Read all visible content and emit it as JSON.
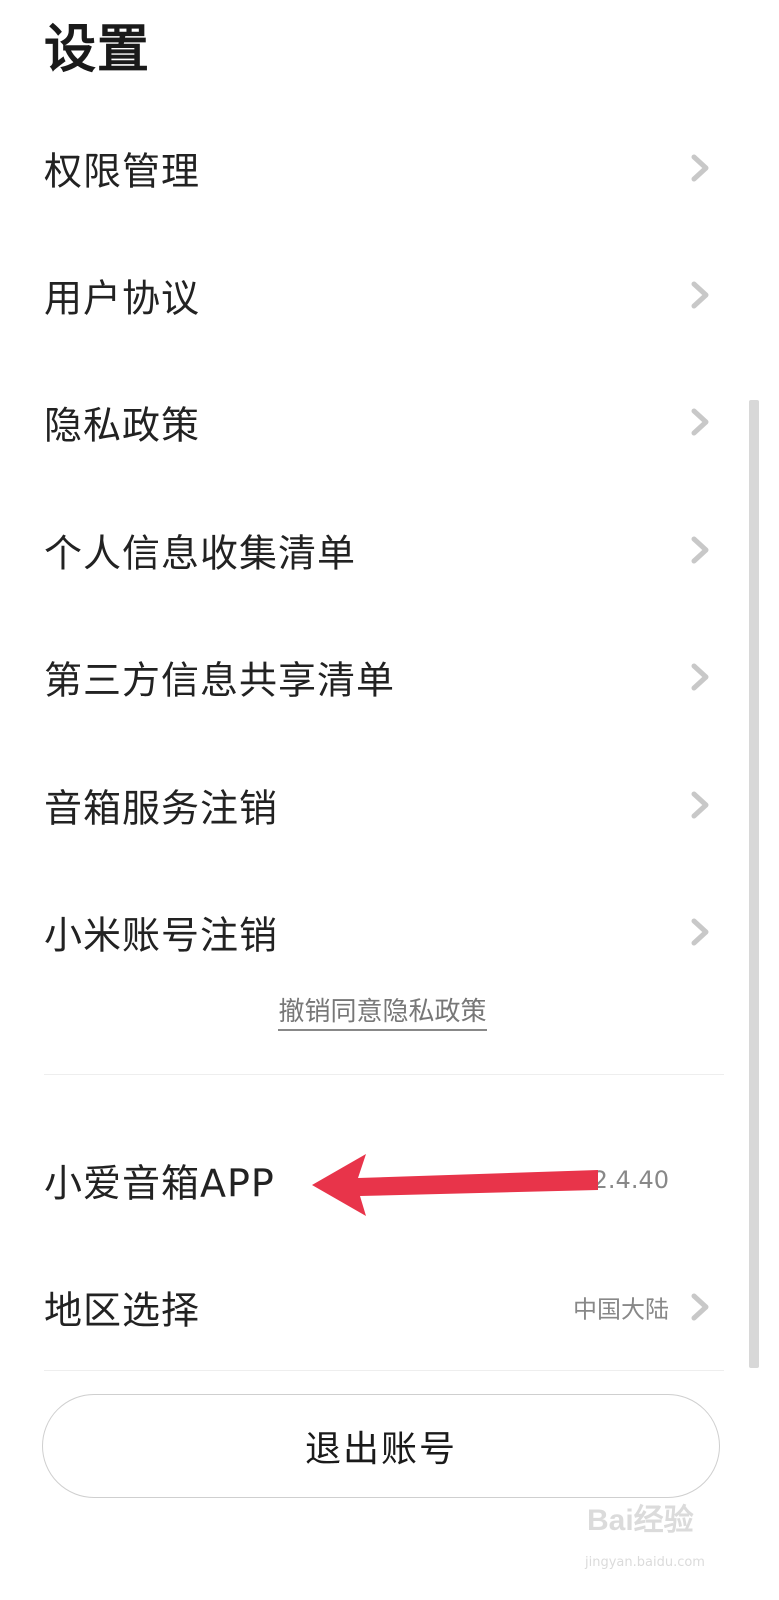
{
  "header": {
    "title": "设置"
  },
  "menu": {
    "items": [
      {
        "label": "权限管理"
      },
      {
        "label": "用户协议"
      },
      {
        "label": "隐私政策"
      },
      {
        "label": "个人信息收集清单"
      },
      {
        "label": "第三方信息共享清单"
      },
      {
        "label": "音箱服务注销"
      },
      {
        "label": "小米账号注销"
      }
    ],
    "revoke_link": "撤销同意隐私政策"
  },
  "info": {
    "app_label": "小爱音箱APP",
    "app_version": "v 2.4.40",
    "region_label": "地区选择",
    "region_value": "中国大陆"
  },
  "footer": {
    "logout_label": "退出账号"
  },
  "watermark": {
    "text": "Bai经验",
    "subtext": "jingyan.baidu.com"
  },
  "colors": {
    "arrow": "#e8344a",
    "chevron": "#c8c8c8",
    "text_primary": "#222222",
    "text_secondary": "#888888"
  }
}
